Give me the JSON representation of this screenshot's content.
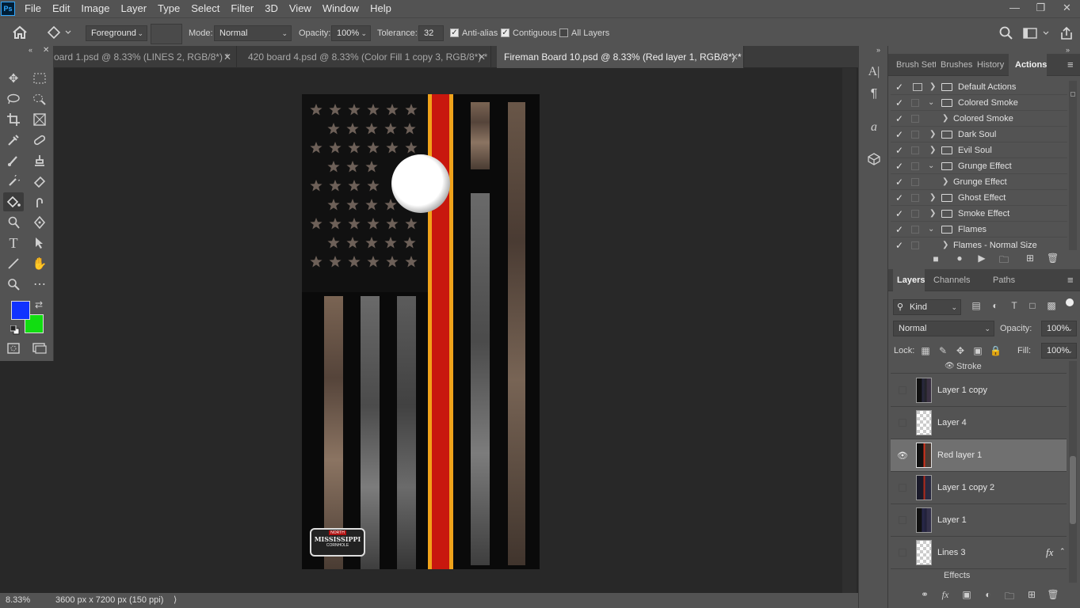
{
  "app": {
    "logo": "Ps"
  },
  "menu": [
    "File",
    "Edit",
    "Image",
    "Layer",
    "Type",
    "Select",
    "Filter",
    "3D",
    "View",
    "Window",
    "Help"
  ],
  "options": {
    "fill_source": "Foreground",
    "mode_label": "Mode:",
    "mode_value": "Normal",
    "opacity_label": "Opacity:",
    "opacity_value": "100%",
    "tolerance_label": "Tolerance:",
    "tolerance_value": "32",
    "antialias_label": "Anti-alias",
    "antialias_checked": true,
    "contiguous_label": "Contiguous",
    "contiguous_checked": true,
    "alllayers_label": "All Layers",
    "alllayers_checked": false
  },
  "tabs": [
    {
      "label": "oard 1.psd @ 8.33% (LINES 2, RGB/8*) *",
      "active": false
    },
    {
      "label": "420 board 4.psd @ 8.33% (Color Fill 1 copy 3, RGB/8*) *",
      "active": false
    },
    {
      "label": "Fireman Board 10.psd @ 8.33% (Red layer 1, RGB/8*) *",
      "active": true
    }
  ],
  "colors": {
    "foreground": "#1133ff",
    "background": "#11dd11",
    "thin_line": "#c8170e",
    "line_edge": "#f0a21a"
  },
  "board_logo": {
    "top": "NORTH",
    "main": "MISSISSIPPI",
    "bottom": "CORNHOLE"
  },
  "status": {
    "zoom": "8.33%",
    "doc_info": "3600 px x 7200 px (150 ppi)"
  },
  "top_panel": {
    "tabs": [
      {
        "label": "Brush Sett",
        "active": false
      },
      {
        "label": "Brushes",
        "active": false
      },
      {
        "label": "History",
        "active": false
      },
      {
        "label": "Actions",
        "active": true
      }
    ],
    "actions": [
      {
        "label": "Default Actions",
        "type": "set",
        "expanded": false
      },
      {
        "label": "Colored Smoke",
        "type": "set",
        "expanded": true
      },
      {
        "label": "Colored Smoke",
        "type": "action"
      },
      {
        "label": "Dark Soul",
        "type": "set",
        "expanded": false
      },
      {
        "label": "Evil Soul",
        "type": "set",
        "expanded": false
      },
      {
        "label": "Grunge Effect",
        "type": "set",
        "expanded": true
      },
      {
        "label": "Grunge Effect",
        "type": "action"
      },
      {
        "label": "Ghost Effect",
        "type": "set",
        "expanded": false
      },
      {
        "label": "Smoke Effect",
        "type": "set",
        "expanded": false
      },
      {
        "label": "Flames",
        "type": "set",
        "expanded": true
      },
      {
        "label": "Flames - Normal Size",
        "type": "action"
      }
    ]
  },
  "layers_panel": {
    "tabs": [
      {
        "label": "Layers",
        "active": true
      },
      {
        "label": "Channels",
        "active": false
      },
      {
        "label": "Paths",
        "active": false
      }
    ],
    "filter_kind": "Kind",
    "blend_mode": "Normal",
    "opacity_label": "Opacity:",
    "opacity_value": "100%",
    "lock_label": "Lock:",
    "fill_label": "Fill:",
    "fill_value": "100%",
    "stroke_label": "Stroke",
    "effects_label": "Effects",
    "fx_label": "fx",
    "layers": [
      {
        "name": "Layer 1 copy",
        "visible": false,
        "selected": false,
        "thumb": "dark"
      },
      {
        "name": "Layer 4",
        "visible": false,
        "selected": false,
        "thumb": "transparent"
      },
      {
        "name": "Red layer 1",
        "visible": true,
        "selected": true,
        "thumb": "redline"
      },
      {
        "name": "Layer 1 copy 2",
        "visible": false,
        "selected": false,
        "thumb": "redline"
      },
      {
        "name": "Layer 1",
        "visible": false,
        "selected": false,
        "thumb": "dark"
      },
      {
        "name": "Lines 3",
        "visible": false,
        "selected": false,
        "thumb": "transparent"
      }
    ]
  }
}
